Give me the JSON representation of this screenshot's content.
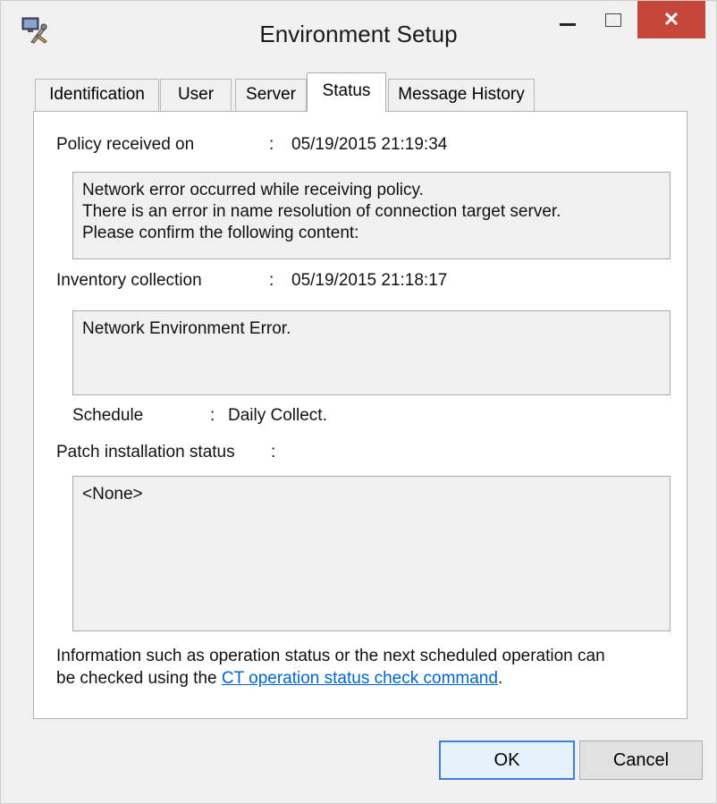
{
  "window": {
    "title": "Environment Setup",
    "close_glyph": "✕"
  },
  "tabs": [
    {
      "label": "Identification"
    },
    {
      "label": "User"
    },
    {
      "label": "Server"
    },
    {
      "label": "Status"
    },
    {
      "label": "Message History"
    }
  ],
  "status": {
    "policy": {
      "label": "Policy received on",
      "colon": ":",
      "value": "05/19/2015 21:19:34",
      "message_lines": [
        "Network error occurred while receiving policy.",
        "There is an error in name resolution of connection target server.",
        "Please confirm the following content:"
      ]
    },
    "inventory": {
      "label": "Inventory collection",
      "colon": ":",
      "value": "05/19/2015 21:18:17",
      "message": "Network Environment Error."
    },
    "schedule": {
      "label": "Schedule",
      "colon": ":",
      "value": "Daily Collect."
    },
    "patch": {
      "label": "Patch installation status",
      "colon": ":",
      "message": "<None>"
    },
    "info": {
      "line1": "Information such as operation status or the next scheduled operation can",
      "line2_prefix": "be checked using the ",
      "link_text": "CT operation status check command",
      "line2_suffix": "."
    }
  },
  "buttons": {
    "ok": "OK",
    "cancel": "Cancel"
  },
  "icons": {
    "app": "settings-tools-icon"
  },
  "colors": {
    "close_button": "#c7463b",
    "link": "#0066cc",
    "default_button_border": "#3c7fd4"
  }
}
